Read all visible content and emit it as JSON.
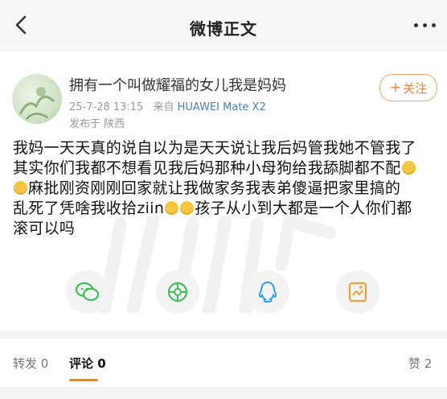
{
  "header": {
    "title": "微博正文"
  },
  "post": {
    "author": "拥有一个叫做耀福的女儿我是妈妈",
    "time": "25-7-28 13:15",
    "source_prefix": "来自",
    "device": "HUAWEI Mate X2",
    "location": "发布于 陕西",
    "follow_label": "关注",
    "content": {
      "line1": "我妈一天天真的说自以为是天天说让我后妈管我她不管我了",
      "line2": "其实你们我都不想看见我后妈那种小母狗给我舔脚都不配",
      "line3": "麻批刚资刚刚回家就让我做家务我表弟傻逼把家里搞的",
      "line4a": "乱死了凭啥我收拾ziin",
      "line4b": "孩子从小到大都是一个人你们都",
      "line5": "滚可以吗"
    }
  },
  "share": {
    "icons": [
      "wechat-icon",
      "moments-icon",
      "qq-icon",
      "save-image-icon"
    ]
  },
  "tabs": {
    "repost": "转发 0",
    "comment": "评论 0",
    "like": "赞 2"
  },
  "colors": {
    "accent": "#ff8200",
    "follow": "#e8823c",
    "wechat": "#3fbf5a",
    "qq": "#2aa3e8"
  }
}
